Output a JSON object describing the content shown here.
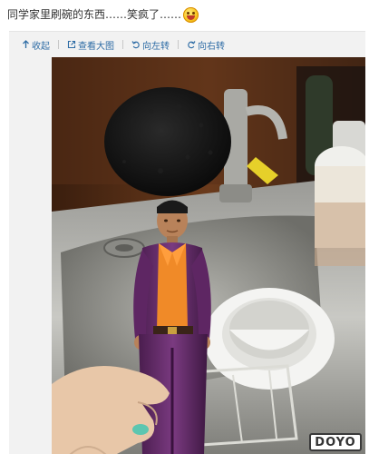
{
  "post": {
    "text": "同学家里刷碗的东西……笑疯了……",
    "emoji": "laughing-face-icon"
  },
  "toolbar": {
    "collapse_label": "收起",
    "view_large_label": "查看大图",
    "rotate_left_label": "向左转",
    "rotate_right_label": "向右转"
  },
  "photo": {
    "watermark": "DOYO"
  },
  "colors": {
    "link": "#2e6ca5",
    "card_bg": "#f2f2f2"
  }
}
